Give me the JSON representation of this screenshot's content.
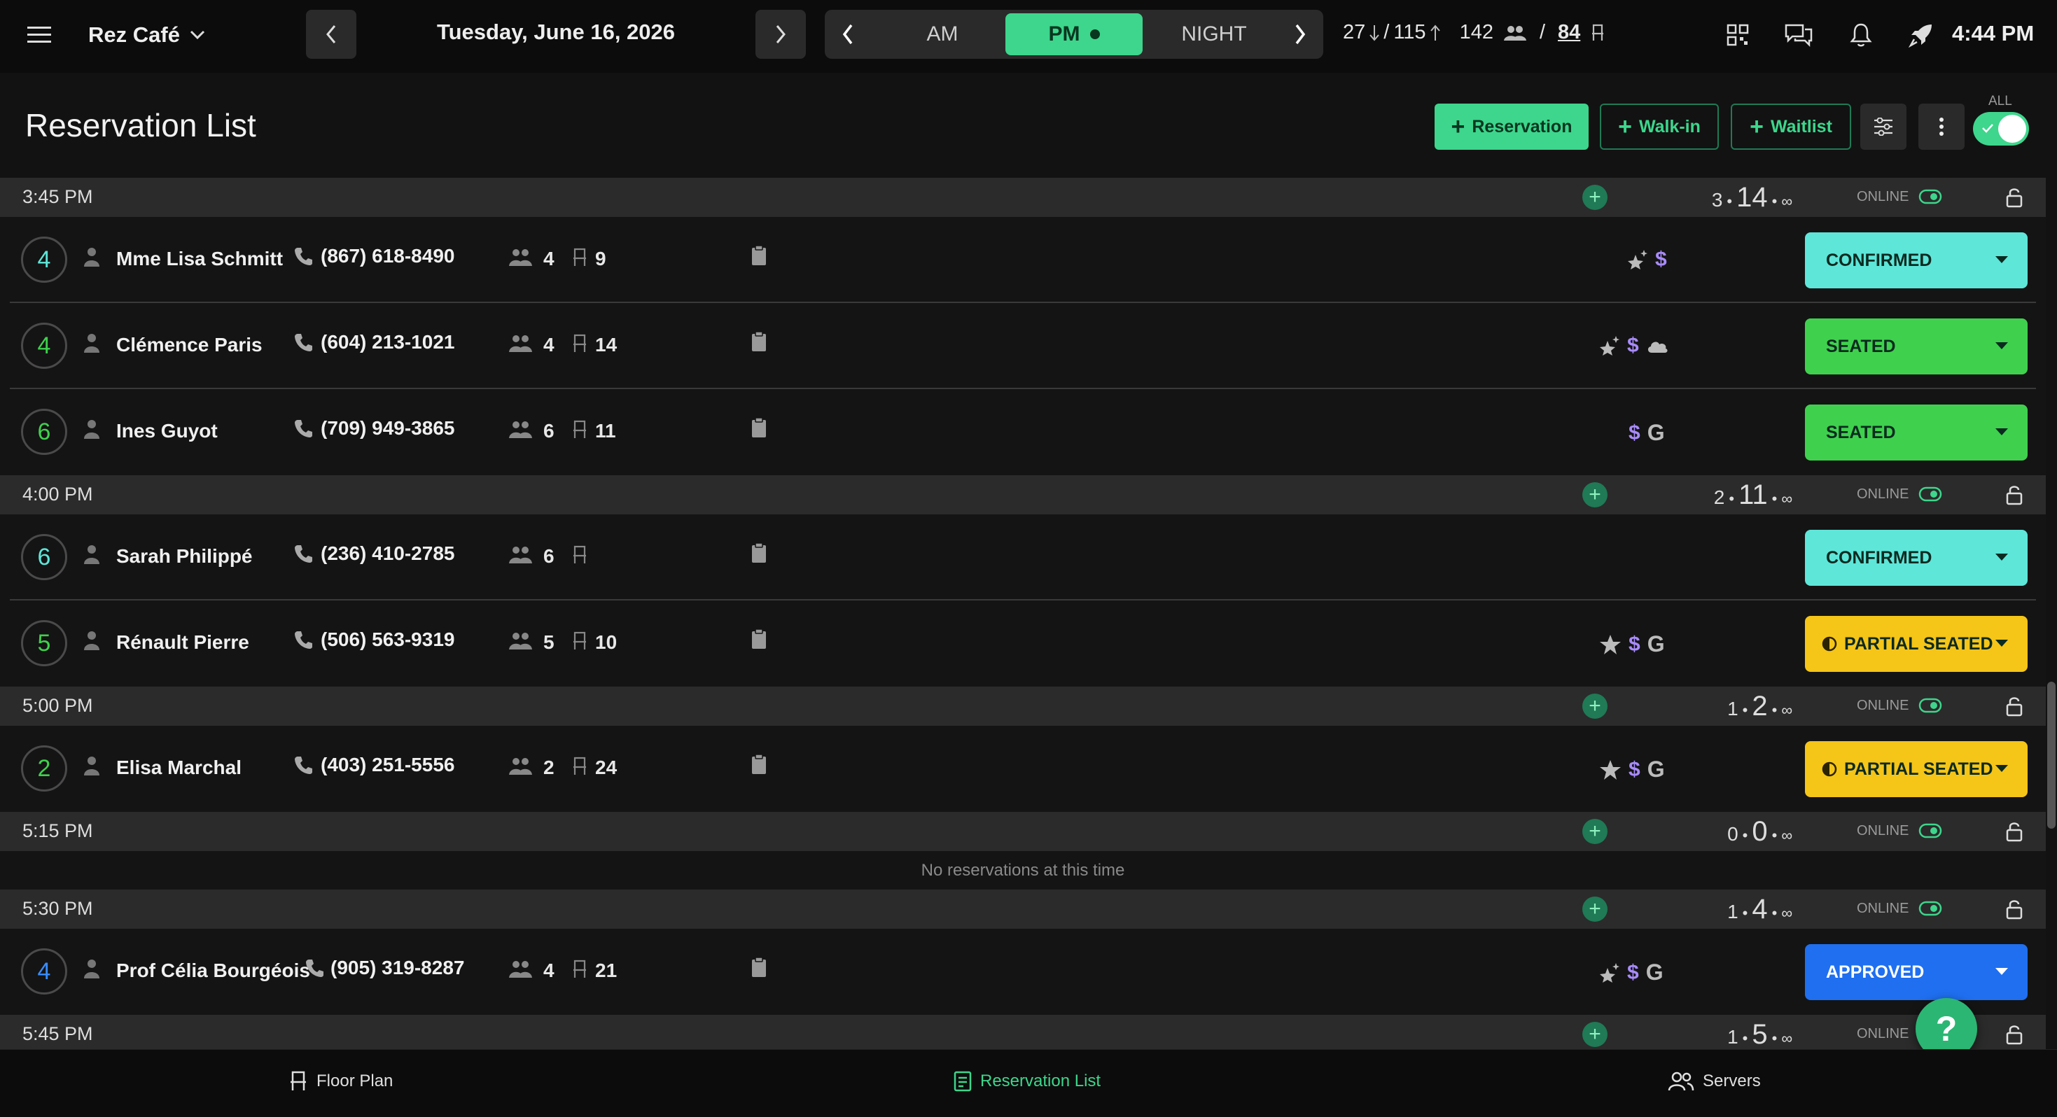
{
  "topbar": {
    "venue": "Rez Café",
    "date": "Tuesday, June 16, 2026",
    "shifts": [
      "AM",
      "PM",
      "NIGHT"
    ],
    "active_shift": "PM",
    "stats": {
      "down": "27",
      "sep1": "/",
      "up": "115",
      "covers": "142",
      "sep2": "/",
      "tables": "84"
    },
    "clock": "4:44 PM"
  },
  "header": {
    "title": "Reservation List",
    "btn_reservation": "Reservation",
    "btn_walkin": "Walk-in",
    "btn_waitlist": "Waitlist",
    "all_label": "ALL"
  },
  "online_label": "ONLINE",
  "slots": [
    {
      "time": "3:45 PM",
      "a": "3",
      "b": "14",
      "c": "∞"
    },
    {
      "time": "4:00 PM",
      "a": "2",
      "b": "11",
      "c": "∞"
    },
    {
      "time": "5:00 PM",
      "a": "1",
      "b": "2",
      "c": "∞"
    },
    {
      "time": "5:15 PM",
      "a": "0",
      "b": "0",
      "c": "∞"
    },
    {
      "time": "5:30 PM",
      "a": "1",
      "b": "4",
      "c": "∞"
    },
    {
      "time": "5:45 PM",
      "a": "1",
      "b": "5",
      "c": "∞"
    }
  ],
  "empty_message": "No reservations at this time",
  "reservations": [
    {
      "party": "4",
      "name": "Mme Lisa Schmitt",
      "phone": "(867) 618-8490",
      "guests": "4",
      "table": "9",
      "status": "CONFIRMED"
    },
    {
      "party": "4",
      "name": "Clémence Paris",
      "phone": "(604) 213-1021",
      "guests": "4",
      "table": "14",
      "status": "SEATED"
    },
    {
      "party": "6",
      "name": "Ines Guyot",
      "phone": "(709) 949-3865",
      "guests": "6",
      "table": "11",
      "status": "SEATED"
    },
    {
      "party": "6",
      "name": "Sarah Philippé",
      "phone": "(236) 410-2785",
      "guests": "6",
      "table": "",
      "status": "CONFIRMED"
    },
    {
      "party": "5",
      "name": "Rénault Pierre",
      "phone": "(506) 563-9319",
      "guests": "5",
      "table": "10",
      "status": "PARTIAL SEATED"
    },
    {
      "party": "2",
      "name": "Elisa Marchal",
      "phone": "(403) 251-5556",
      "guests": "2",
      "table": "24",
      "status": "PARTIAL SEATED"
    },
    {
      "party": "4",
      "name": "Prof Célia Bourgéois",
      "phone": "(905) 319-8287",
      "guests": "4",
      "table": "21",
      "status": "APPROVED"
    }
  ],
  "tag_symbols": {
    "dollar": "$",
    "google": "G"
  },
  "bottomnav": {
    "floor_plan": "Floor Plan",
    "reservation_list": "Reservation List",
    "servers": "Servers"
  },
  "help": "?",
  "colors": {
    "accent": "#3dd68c",
    "confirmed": "#5ee6d9",
    "seated": "#3fd14d",
    "partial": "#f5c518",
    "approved": "#1f6ff0"
  }
}
